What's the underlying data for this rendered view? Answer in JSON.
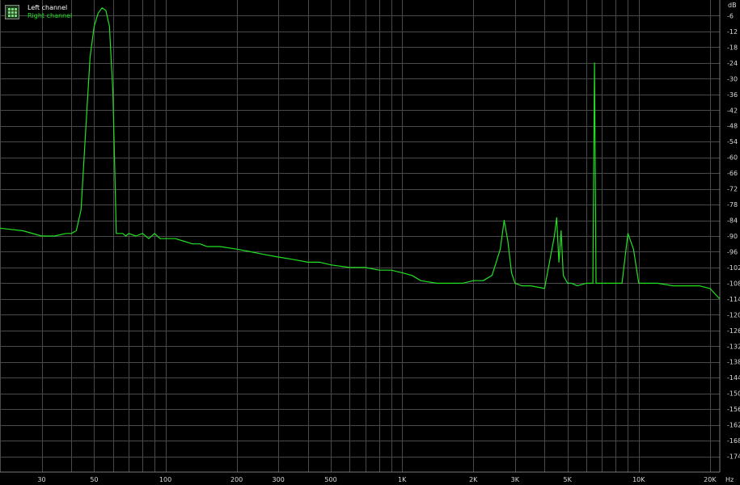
{
  "chart_data": {
    "type": "line",
    "x_scale": "log",
    "xlim": [
      20,
      22000
    ],
    "ylim": [
      -180,
      0
    ],
    "grid": true,
    "legend_placement": "top-left",
    "y_unit": "dB",
    "x_unit": "Hz",
    "y_ticks": [
      "-6",
      "-12",
      "-18",
      "-24",
      "-30",
      "-36",
      "-42",
      "-48",
      "-54",
      "-60",
      "-66",
      "-72",
      "-78",
      "-84",
      "-90",
      "-96",
      "-102",
      "-108",
      "-114",
      "-120",
      "-126",
      "-132",
      "-138",
      "-144",
      "-150",
      "-156",
      "-162",
      "-168",
      "-174"
    ],
    "y_tick_values": [
      -6,
      -12,
      -18,
      -24,
      -30,
      -36,
      -42,
      -48,
      -54,
      -60,
      -66,
      -72,
      -78,
      -84,
      -90,
      -96,
      -102,
      -108,
      -114,
      -120,
      -126,
      -132,
      -138,
      -144,
      -150,
      -156,
      -162,
      -168,
      -174
    ],
    "x_ticks": [
      "30",
      "50",
      "100",
      "200",
      "300",
      "500",
      "1K",
      "2K",
      "3K",
      "5K",
      "10K",
      "20K"
    ],
    "x_tick_values": [
      30,
      50,
      100,
      200,
      300,
      500,
      1000,
      2000,
      3000,
      5000,
      10000,
      20000
    ],
    "series": [
      {
        "name": "Left channel",
        "color": "#ffffff",
        "x": [],
        "y": []
      },
      {
        "name": "Right channel",
        "color": "#22e022",
        "x": [
          20,
          25,
          30,
          34,
          38,
          40,
          42,
          44,
          46,
          48,
          50,
          52,
          54,
          56,
          58,
          60,
          62,
          64,
          66,
          68,
          70,
          75,
          80,
          85,
          90,
          95,
          100,
          110,
          120,
          130,
          140,
          150,
          170,
          200,
          230,
          260,
          300,
          350,
          400,
          450,
          500,
          600,
          700,
          800,
          900,
          1000,
          1100,
          1200,
          1400,
          1600,
          1800,
          2000,
          2200,
          2400,
          2600,
          2700,
          2800,
          2900,
          3000,
          3200,
          3500,
          4000,
          4400,
          4500,
          4600,
          4700,
          4800,
          5000,
          5200,
          5500,
          6000,
          6400,
          6500,
          6600,
          7000,
          8000,
          8500,
          9000,
          9500,
          10000,
          12000,
          14000,
          15000,
          16000,
          18000,
          20000,
          22000
        ],
        "y": [
          -87,
          -88,
          -90,
          -90,
          -89,
          -89,
          -88,
          -80,
          -50,
          -22,
          -10,
          -5,
          -3,
          -4,
          -10,
          -35,
          -89,
          -89,
          -89,
          -90,
          -89,
          -90,
          -89,
          -91,
          -89,
          -91,
          -91,
          -91,
          -92,
          -93,
          -93,
          -94,
          -94,
          -95,
          -96,
          -97,
          -98,
          -99,
          -100,
          -100,
          -101,
          -102,
          -102,
          -103,
          -103,
          -104,
          -105,
          -107,
          -108,
          -108,
          -108,
          -107,
          -107,
          -105,
          -95,
          -84,
          -92,
          -104,
          -108,
          -109,
          -109,
          -110,
          -90,
          -83,
          -100,
          -88,
          -105,
          -108,
          -108,
          -109,
          -108,
          -108,
          -24,
          -108,
          -108,
          -108,
          -108,
          -89,
          -95,
          -108,
          -108,
          -109,
          -109,
          -109,
          -109,
          -110,
          -114
        ]
      }
    ]
  }
}
